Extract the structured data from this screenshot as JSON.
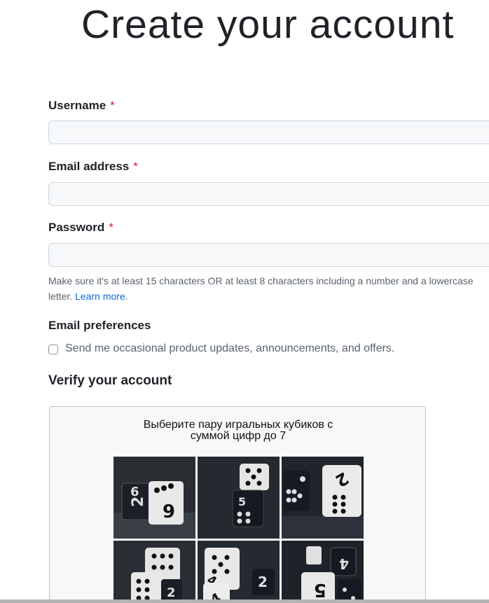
{
  "header": {
    "title": "Create your account"
  },
  "form": {
    "username": {
      "label": "Username",
      "required_mark": "*",
      "value": ""
    },
    "email": {
      "label": "Email address",
      "required_mark": "*",
      "value": ""
    },
    "password": {
      "label": "Password",
      "required_mark": "*",
      "value": ""
    },
    "password_hint": {
      "text": "Make sure it's at least 15 characters OR at least 8 characters including a number and a lowercase letter.",
      "link_text": "Learn more",
      "trailing": "."
    },
    "email_preferences": {
      "title": "Email preferences",
      "checkbox_label": "Send me occasional product updates, announcements, and offers.",
      "checked": false
    }
  },
  "verify": {
    "title": "Verify your account",
    "captcha": {
      "instruction_line1": "Выберите пару игральных кубиков с",
      "instruction_line2": "суммой цифр до 7",
      "tiles": [
        {
          "name": "captcha-tile-1",
          "dice": "2 and 6 digit dice"
        },
        {
          "name": "captcha-tile-2",
          "dice": "dot dice and 5"
        },
        {
          "name": "captcha-tile-3",
          "dice": "dot dice and 2"
        },
        {
          "name": "captcha-tile-4",
          "dice": "dot dice"
        },
        {
          "name": "captcha-tile-5",
          "dice": "dot dice, 4 and 2"
        },
        {
          "name": "captcha-tile-6",
          "dice": "4 and 5 digit dice"
        }
      ]
    }
  },
  "colors": {
    "required": "#cf222e",
    "link": "#0969da",
    "input_bg": "#f6f8fa",
    "input_border": "#d0d7de",
    "muted_text": "#59636e"
  }
}
